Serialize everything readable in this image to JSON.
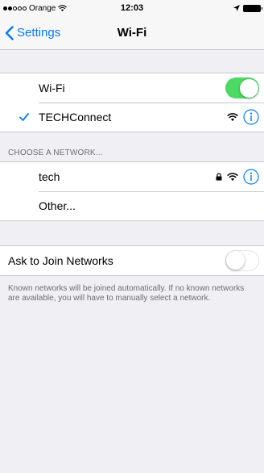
{
  "status_bar": {
    "carrier": "Orange",
    "time": "12:03",
    "signal_strength": 2,
    "signal_max": 5
  },
  "nav": {
    "back_label": "Settings",
    "title": "Wi-Fi"
  },
  "wifi": {
    "label": "Wi-Fi",
    "enabled": true,
    "connected_network": "TECHConnect"
  },
  "networks": {
    "header": "CHOOSE A NETWORK...",
    "items": [
      {
        "name": "tech",
        "secured": true
      },
      {
        "name": "Other..."
      }
    ]
  },
  "ask_to_join": {
    "label": "Ask to Join Networks",
    "enabled": false,
    "footer": "Known networks will be joined automatically. If no known networks are available, you will have to manually select a network."
  },
  "colors": {
    "accent": "#007aff",
    "toggle_on": "#4cd964",
    "background": "#efeff4"
  }
}
